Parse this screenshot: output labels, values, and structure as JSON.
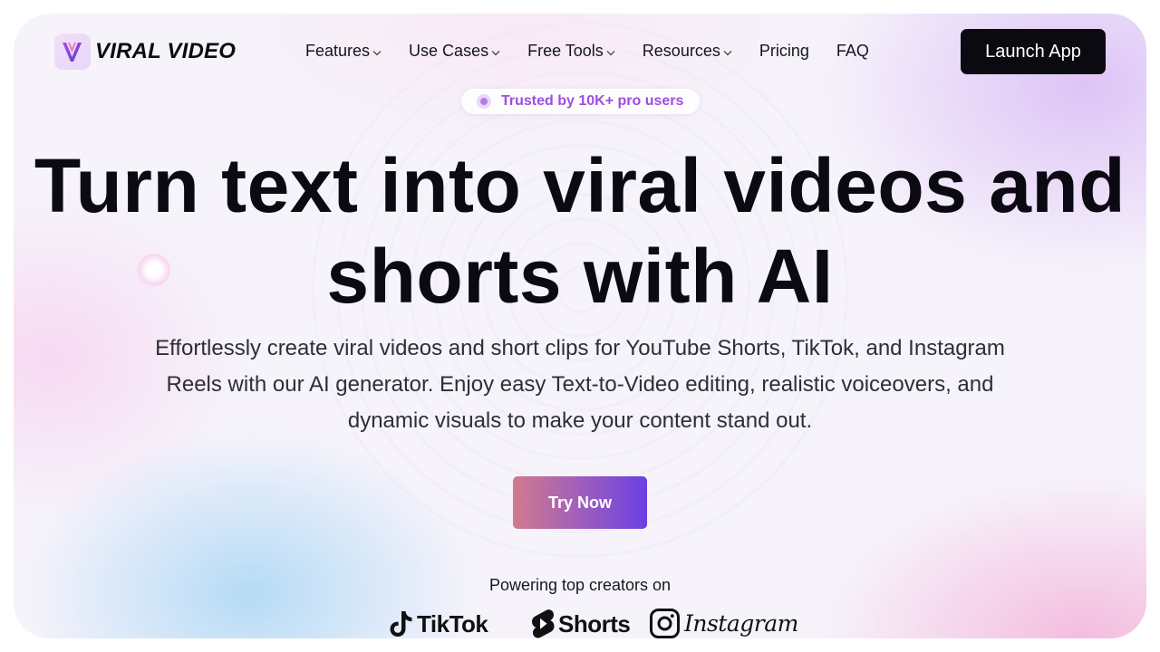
{
  "brand": {
    "name": "VIRAL VIDEO",
    "logo_icon": "v-logo-icon"
  },
  "nav": {
    "items": [
      {
        "label": "Features",
        "has_dropdown": true
      },
      {
        "label": "Use Cases",
        "has_dropdown": true
      },
      {
        "label": "Free Tools",
        "has_dropdown": true
      },
      {
        "label": "Resources",
        "has_dropdown": true
      },
      {
        "label": "Pricing",
        "has_dropdown": false
      },
      {
        "label": "FAQ",
        "has_dropdown": false
      }
    ],
    "cta_label": "Launch App"
  },
  "badge": {
    "text": "Trusted by 10K+ pro users"
  },
  "hero": {
    "headline_line1": "Turn text into viral videos and",
    "headline_line2": "shorts with AI",
    "subtext": "Effortlessly create viral videos and short clips for YouTube Shorts, TikTok, and Instagram Reels with our AI generator. Enjoy easy Text-to-Video editing, realistic voiceovers, and dynamic visuals to make your content stand out.",
    "cta_label": "Try Now"
  },
  "platforms": {
    "caption": "Powering top creators on",
    "items": [
      {
        "label": "TikTok",
        "icon": "tiktok-icon"
      },
      {
        "label": "Shorts",
        "icon": "youtube-shorts-icon"
      },
      {
        "label": "Instagram",
        "icon": "instagram-icon"
      }
    ]
  },
  "colors": {
    "accent_purple": "#9b4fe0",
    "button_dark": "#0b0a10",
    "cta_gradient_start": "#d27a8c",
    "cta_gradient_end": "#6a3fe3"
  }
}
